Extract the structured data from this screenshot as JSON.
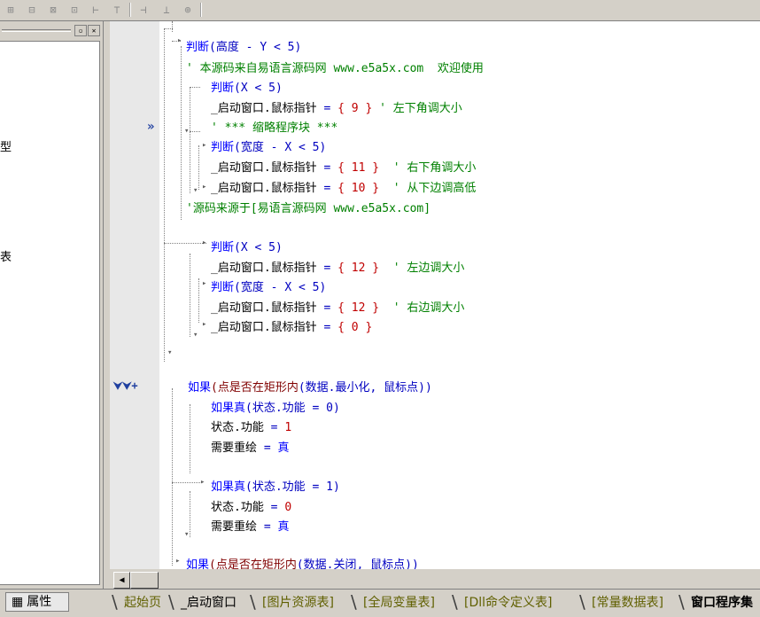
{
  "toolbar": {
    "icons": [
      "align-left-icon",
      "align-center-icon",
      "align-top-icon",
      "align-right-icon",
      "same-width-icon",
      "same-height-icon",
      "spread-horizontal-icon",
      "spread-vertical-icon",
      "center-icon"
    ],
    "glyphs": [
      "⊞",
      "⊟",
      "⊠",
      "⊡",
      "⊢",
      "⊤",
      "⊣",
      "⊥",
      "⊕"
    ]
  },
  "leftpanel": {
    "restore_glyph": "▫",
    "close_glyph": "✕",
    "frag1": "型",
    "frag2": "表"
  },
  "gutter": {
    "marker_arrow": "»",
    "marker_plus": "⮟⮟+"
  },
  "code": {
    "l1_kw": "判断",
    "l1_rest": "(高度 - Y < 5)",
    "l2_cm": "' 本源码来自易语言源码网 www.e5a5x.com  欢迎使用",
    "l3_kw": "判断",
    "l3_rest": "(X < 5)",
    "l4_obj": "_启动窗口.鼠标指针",
    "l4_eq": " = ",
    "l4_val": "{ 9 }",
    "l4_cm": " ' 左下角调大小",
    "l5_cm": "' *** 缩略程序块 ***",
    "l6_kw": "判断",
    "l6_rest": "(宽度 - X < 5)",
    "l7_obj": "_启动窗口.鼠标指针",
    "l7_eq": " = ",
    "l7_val": "{ 11 }",
    "l7_cm": "  ' 右下角调大小",
    "l8_obj": "_启动窗口.鼠标指针",
    "l8_eq": " = ",
    "l8_val": "{ 10 }",
    "l8_cm": "  ' 从下边调高低",
    "l9_cm": "'源码来源于[易语言源码网 www.e5a5x.com]",
    "l10_kw": "判断",
    "l10_rest": "(X < 5)",
    "l11_obj": "_启动窗口.鼠标指针",
    "l11_eq": " = ",
    "l11_val": "{ 12 }",
    "l11_cm": "  ' 左边调大小",
    "l12_kw": "判断",
    "l12_rest": "(宽度 - X < 5)",
    "l13_obj": "_启动窗口.鼠标指针",
    "l13_eq": " = ",
    "l13_val": "{ 12 }",
    "l13_cm": "  ' 右边调大小",
    "l14_obj": "_启动窗口.鼠标指针",
    "l14_eq": " = ",
    "l14_val": "{ 0 }",
    "l15_kw": "如果",
    "l15_fn": "(点是否在矩形内",
    "l15_rest": "(数据.最小化, 鼠标点))",
    "l16_kw": "如果真",
    "l16_rest": "(状态.功能 = 0)",
    "l17_obj": "状态.功能",
    "l17_eq": " = ",
    "l17_val": "1",
    "l18_obj": "需要重绘",
    "l18_eq": " = ",
    "l18_val": "真",
    "l19_kw": "如果真",
    "l19_rest": "(状态.功能 = 1)",
    "l20_obj": "状态.功能",
    "l20_eq": " = ",
    "l20_val": "0",
    "l21_obj": "需要重绘",
    "l21_eq": " = ",
    "l21_val": "真",
    "l22_kw": "如果",
    "l22_fn": "(点是否在矩形内",
    "l22_rest": "(数据.关闭, 鼠标点))"
  },
  "scroll": {
    "left_glyph": "◀"
  },
  "tabs": {
    "props_label": "属性",
    "items": [
      "起始页",
      "_启动窗口",
      "[图片资源表]",
      "[全局变量表]",
      "[Dll命令定义表]",
      "[常量数据表]",
      "窗口程序集"
    ]
  }
}
